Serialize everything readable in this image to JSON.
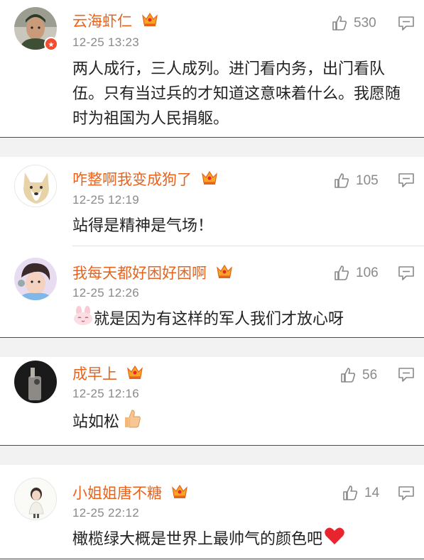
{
  "comments": [
    {
      "username": "云海虾仁",
      "time": "12-25 13:23",
      "likes": "530",
      "text": "两人成行，三人成列。进门看内务，出门看队伍。只有当过兵的才知道这意味着什么。我愿随时为祖国为人民捐躯。",
      "avatar": "soldier-avatar",
      "badge_icon": "vip-crown-icon"
    },
    {
      "username": "咋整啊我变成狗了",
      "time": "12-25 12:19",
      "likes": "105",
      "text": "站得是精神是气场！",
      "avatar": "dog-avatar",
      "badge_icon": "vip-crown-icon"
    },
    {
      "username": "我每天都好困好困啊",
      "time": "12-25 12:26",
      "likes": "106",
      "text": "就是因为有这样的军人我们才放心呀",
      "avatar": "boy-avatar",
      "badge_icon": "vip-crown-icon",
      "leading_emoji": "bunny-face-emoji"
    },
    {
      "username": "成早上",
      "time": "12-25 12:16",
      "likes": "56",
      "text": "站如松",
      "avatar": "dark-avatar",
      "badge_icon": "vip-crown-icon",
      "trailing_emoji": "thumbs-up-emoji"
    },
    {
      "username": "小姐姐唐不糖",
      "time": "12-25 22:12",
      "likes": "14",
      "text": "橄榄绿大概是世界上最帅气的颜色吧",
      "avatar": "girl-avatar",
      "badge_icon": "vip-crown-icon",
      "trailing_emoji": "red-heart-emoji"
    }
  ],
  "colors": {
    "username": "#e8641d",
    "meta": "#8a8a8a",
    "text": "#222222",
    "gap": "#f2f2f2"
  }
}
